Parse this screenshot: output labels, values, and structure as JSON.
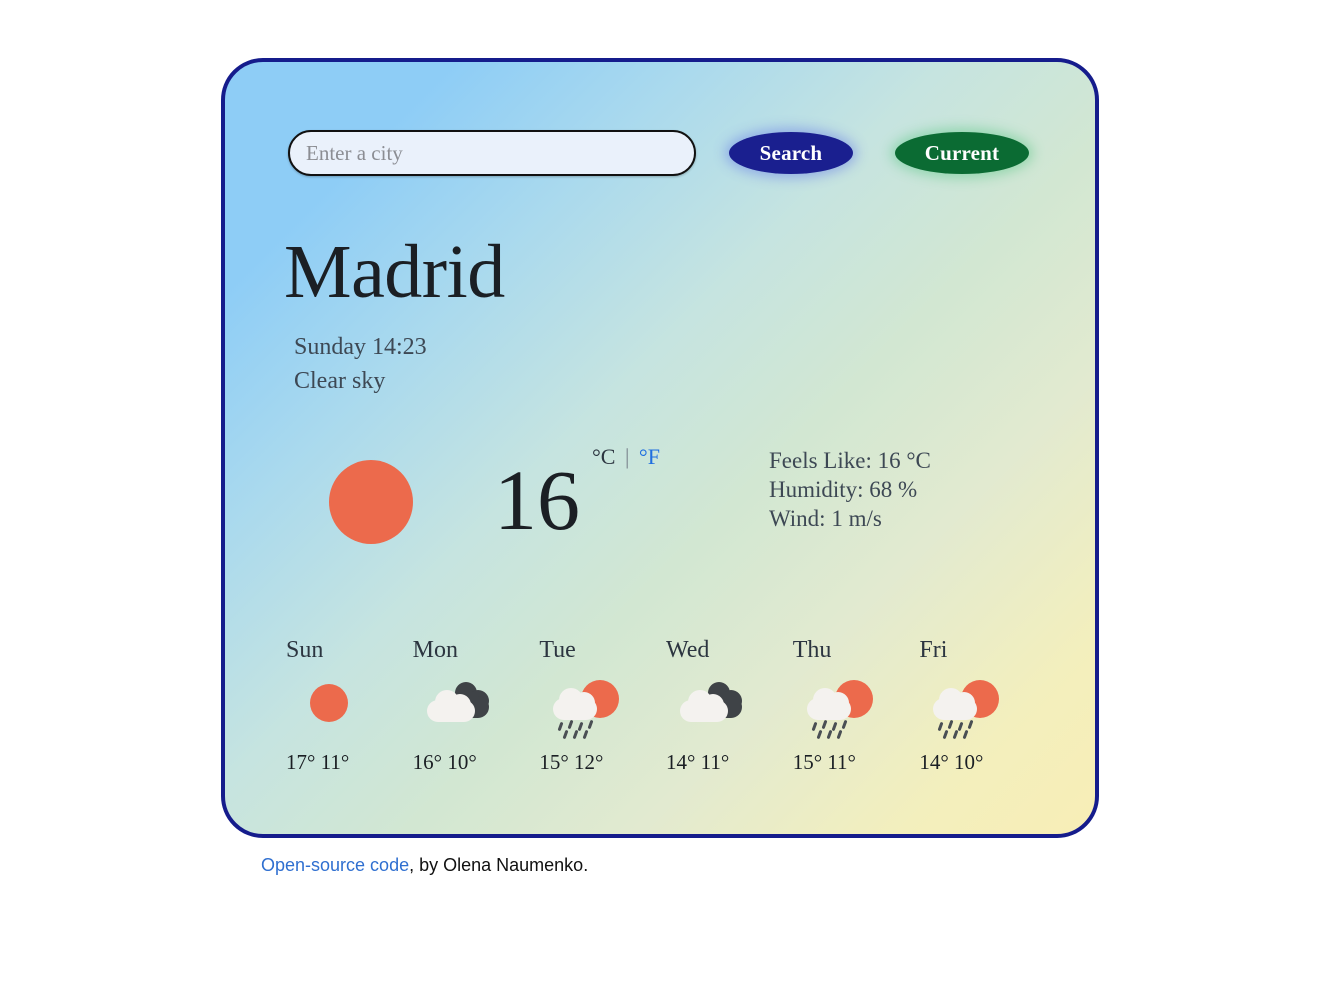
{
  "search": {
    "placeholder": "Enter a city",
    "value": "",
    "search_label": "Search",
    "current_label": "Current"
  },
  "current": {
    "city": "Madrid",
    "datetime": "Sunday 14:23",
    "description": "Clear sky",
    "icon": "sun-icon",
    "temperature": "16",
    "unit_celsius": "°C",
    "unit_separator": "|",
    "unit_fahrenheit": "°F",
    "feels_like": "Feels Like: 16 °C",
    "humidity": "Humidity: 68 %",
    "wind": "Wind: 1 m/s"
  },
  "forecast": [
    {
      "day": "Sun",
      "icon": "sun-icon",
      "temps": "17° 11°",
      "max": "17°",
      "min": "11°"
    },
    {
      "day": "Mon",
      "icon": "clouds-icon",
      "temps": "16° 10°",
      "max": "16°",
      "min": "10°"
    },
    {
      "day": "Tue",
      "icon": "sun-rain-cloud-icon",
      "temps": "15° 12°",
      "max": "15°",
      "min": "12°"
    },
    {
      "day": "Wed",
      "icon": "clouds-icon",
      "temps": "14° 11°",
      "max": "14°",
      "min": "11°"
    },
    {
      "day": "Thu",
      "icon": "sun-rain-cloud-icon",
      "temps": "15° 11°",
      "max": "15°",
      "min": "11°"
    },
    {
      "day": "Fri",
      "icon": "sun-rain-cloud-icon",
      "temps": "14° 10°",
      "max": "14°",
      "min": "10°"
    }
  ],
  "footer": {
    "link_text": "Open-source code",
    "rest_text": ", by Olena Naumenko."
  },
  "colors": {
    "border": "#151c8c",
    "search_button": "#1a1f8f",
    "current_button": "#0b6b33",
    "sun": "#ec6a4c",
    "link": "#2f6fd0",
    "gradient_start": "#8ecdf6",
    "gradient_mid": "#d2e7d2",
    "gradient_end": "#f8eeb6"
  }
}
